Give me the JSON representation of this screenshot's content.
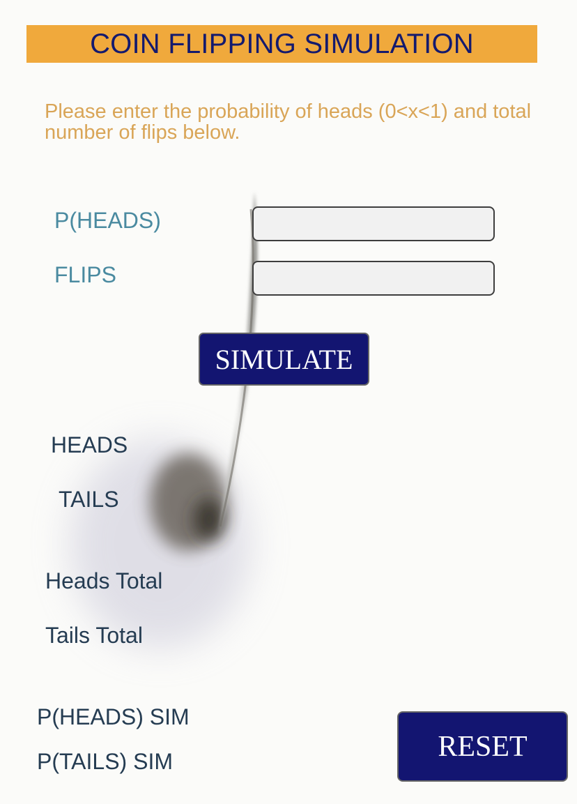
{
  "header": {
    "title": "COIN FLIPPING SIMULATION"
  },
  "instructions": "Please enter the probability of heads (0<x<1)  and total number of flips below.",
  "form": {
    "p_heads_label": "P(HEADS)",
    "p_heads_value": "",
    "flips_label": "FLIPS",
    "flips_value": "",
    "simulate_label": "SIMULATE"
  },
  "results": {
    "heads_label": "HEADS",
    "tails_label": "TAILS",
    "heads_total_label": "Heads Total",
    "tails_total_label": "Tails Total",
    "p_heads_sim_label": "P(HEADS) SIM",
    "p_tails_sim_label": "P(TAILS) SIM"
  },
  "actions": {
    "reset_label": "RESET"
  },
  "colors": {
    "title_bar": "#f0a93c",
    "title_text": "#141a6e",
    "instructions_text": "#d9a557",
    "field_label": "#4a8aa0",
    "button_bg": "#131571",
    "result_text": "#253c52"
  },
  "background_image": "spinning-coin"
}
